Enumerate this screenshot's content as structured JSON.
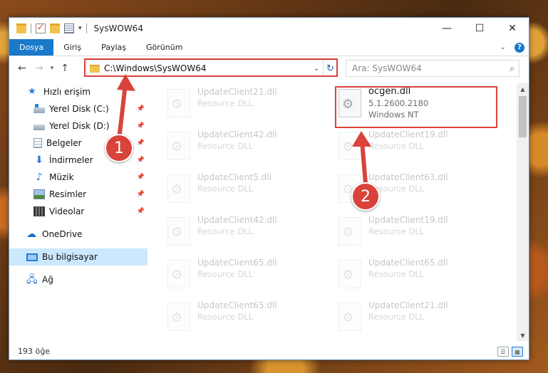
{
  "window": {
    "title": "SysWOW64",
    "controls": {
      "minimize": "—",
      "maximize": "☐",
      "close": "✕"
    }
  },
  "ribbon": {
    "tabs": [
      "Dosya",
      "Giriş",
      "Paylaş",
      "Görünüm"
    ],
    "collapse_icon": "chevron-down-icon",
    "help": "?"
  },
  "nav": {
    "back": "←",
    "forward": "→",
    "recent": "▾",
    "up": "↑",
    "address": "C:\\Windows\\SysWOW64",
    "refresh": "↻",
    "search_placeholder": "Ara: SysWOW64"
  },
  "sidebar": {
    "items": [
      {
        "label": "Hızlı erişim",
        "icon": "star-icon",
        "pinned": false
      },
      {
        "label": "Yerel Disk (C:)",
        "icon": "drive-icon",
        "pinned": true
      },
      {
        "label": "Yerel Disk (D:)",
        "icon": "drive-icon",
        "pinned": true
      },
      {
        "label": "Belgeler",
        "icon": "documents-icon",
        "pinned": true
      },
      {
        "label": "İndirmeler",
        "icon": "download-icon",
        "pinned": true
      },
      {
        "label": "Müzik",
        "icon": "music-icon",
        "pinned": true
      },
      {
        "label": "Resimler",
        "icon": "pictures-icon",
        "pinned": true
      },
      {
        "label": "Videolar",
        "icon": "videos-icon",
        "pinned": true
      },
      {
        "label": "OneDrive",
        "icon": "cloud-icon",
        "pinned": false
      },
      {
        "label": "Bu bilgisayar",
        "icon": "computer-icon",
        "pinned": false,
        "selected": true
      },
      {
        "label": "Ağ",
        "icon": "network-icon",
        "pinned": false
      }
    ]
  },
  "files": {
    "highlighted": {
      "name": "ocgen.dll",
      "line2": "5.1.2600.2180",
      "line3": "Windows NT"
    },
    "left_column": [
      {
        "name": "UpdateClient21.dll",
        "type": "Resource DLL"
      },
      {
        "name": "UpdateClient42.dll",
        "type": "Resource DLL"
      },
      {
        "name": "UpdateClient5.dll",
        "type": "Resource DLL"
      },
      {
        "name": "UpdateClient42.dll",
        "type": "Resource DLL"
      },
      {
        "name": "UpdateClient65.dll",
        "type": "Resource DLL"
      },
      {
        "name": "UpdateClient65.dll",
        "type": "Resource DLL"
      }
    ],
    "right_column": [
      {
        "name": "UpdateClient19.dll",
        "type": "Resource DLL"
      },
      {
        "name": "UpdateClient63.dll",
        "type": "Resource DLL"
      },
      {
        "name": "UpdateClient19.dll",
        "type": "Resource DLL"
      },
      {
        "name": "UpdateClient65.dll",
        "type": "Resource DLL"
      },
      {
        "name": "UpdateClient21.dll",
        "type": "Resource DLL"
      }
    ]
  },
  "status": {
    "count": "193 öğe"
  },
  "callouts": {
    "one": "1",
    "two": "2"
  },
  "colors": {
    "accent": "#1979ca",
    "highlight": "#d9433b",
    "selected": "#cce8ff"
  }
}
